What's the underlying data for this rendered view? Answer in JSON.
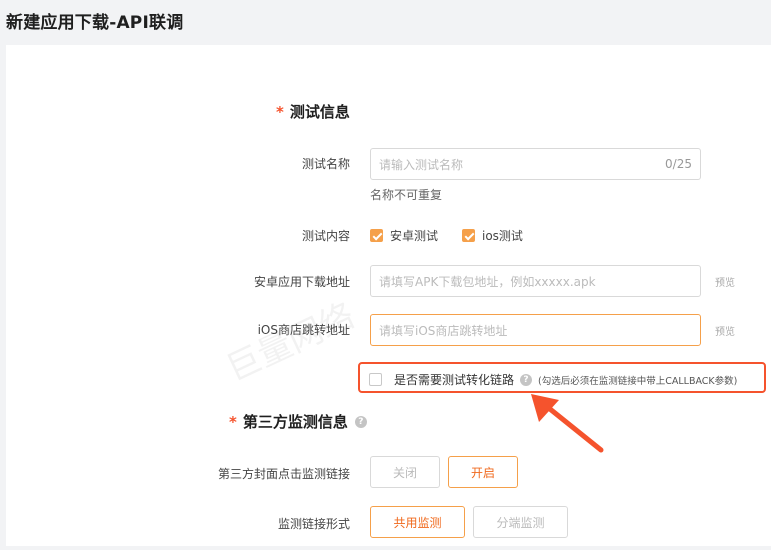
{
  "page": {
    "title": "新建应用下载-API联调"
  },
  "watermark": "巨量网络",
  "test_info": {
    "section_title": "测试信息",
    "required_mark": "*",
    "name_field": {
      "label": "测试名称",
      "placeholder": "请输入测试名称",
      "counter": "0/25",
      "hint": "名称不可重复"
    },
    "content_field": {
      "label": "测试内容",
      "options": [
        {
          "label": "安卓测试",
          "checked": true
        },
        {
          "label": "ios测试",
          "checked": true
        }
      ]
    },
    "android_url": {
      "label": "安卓应用下载地址",
      "placeholder": "请填写APK下载包地址，例如xxxxx.apk",
      "preview": "预览"
    },
    "ios_url": {
      "label": "iOS商店跳转地址",
      "placeholder": "请填写iOS商店跳转地址",
      "preview": "预览"
    },
    "conversion_link": {
      "label": "是否需要测试转化链路",
      "checked": false,
      "note": "(勾选后必须在监测链接中带上CALLBACK参数)"
    }
  },
  "third_party": {
    "section_title": "第三方监测信息",
    "required_mark": "*",
    "cover_click": {
      "label": "第三方封面点击监测链接",
      "options": [
        "关闭",
        "开启"
      ],
      "selected": "开启"
    },
    "link_form": {
      "label": "监测链接形式",
      "options": [
        "共用监测",
        "分端监测"
      ],
      "selected": "共用监测"
    }
  },
  "colors": {
    "accent": "#f5a04a",
    "required": "#f5532d",
    "annotation": "#f5532d"
  }
}
